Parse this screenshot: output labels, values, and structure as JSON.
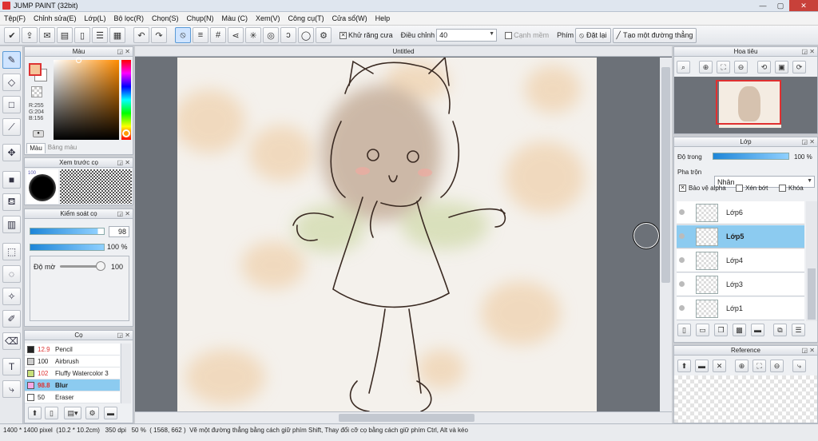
{
  "window": {
    "title": "JUMP PAINT (32bit)",
    "min": "—",
    "max": "▢",
    "close": "✕"
  },
  "menu": [
    "Tệp(F)",
    "Chỉnh sửa(E)",
    "Lớp(L)",
    "Bộ lọc(R)",
    "Chọn(S)",
    "Chụp(N)",
    "Màu (C)",
    "Xem(V)",
    "Công cụ(T)",
    "Cửa sổ(W)",
    "Help"
  ],
  "toolbar": {
    "antialias_label": "Khử răng cưa",
    "adjust_label": "Điều chỉnh",
    "adjust_value": "40",
    "edge_label": "Cạnh mềm",
    "key_label": "Phím",
    "reset_label": "Đặt lại",
    "line_label": "Tạo một đường thẳng"
  },
  "color_panel": {
    "title": "Màu",
    "r": "R:255",
    "g": "G:204",
    "b": "B:156",
    "tab_color": "Màu",
    "tab_palette": "Bảng màu",
    "fg": "#f4c59a",
    "bg": "#ffffff"
  },
  "brush_preview": {
    "title": "Xem trước cọ",
    "size": "100"
  },
  "brush_control": {
    "title": "Kiểm soát cọ",
    "size_value": "98",
    "size_fill": 0.92,
    "opacity_value": "100 %",
    "opacity_fill": 1.0,
    "density_label": "Độ mờ",
    "density_value": "100"
  },
  "brushes": {
    "title": "Cọ",
    "items": [
      {
        "size": "12.9",
        "name": "Pencil",
        "color": "#222222",
        "size_color": "#d33"
      },
      {
        "size": "100",
        "name": "Airbrush",
        "color": "#cccccc",
        "size_color": "#222"
      },
      {
        "size": "102",
        "name": "Fluffy Watercolor 3",
        "color": "#c8e07a",
        "size_color": "#d33"
      },
      {
        "size": "98.8",
        "name": "Blur",
        "color": "#f7a8e4",
        "size_color": "#d33"
      },
      {
        "size": "50",
        "name": "Eraser",
        "color": "#ffffff",
        "size_color": "#222"
      }
    ]
  },
  "canvas": {
    "tab": "Untitled"
  },
  "navigator": {
    "title": "Hoa tiêu"
  },
  "layers_panel": {
    "title": "Lớp",
    "opacity_label": "Độ trong",
    "opacity_value": "100 %",
    "opacity_fill": 1.0,
    "blend_label": "Pha trộn",
    "blend_value": "Nhân",
    "protect_alpha": "Bảo vệ alpha",
    "clip": "Xén bớt",
    "lock": "Khóa",
    "layers": [
      {
        "name": "Lớp6",
        "selected": false
      },
      {
        "name": "Lớp5",
        "selected": true
      },
      {
        "name": "Lớp4",
        "selected": false
      },
      {
        "name": "Lớp3",
        "selected": false
      },
      {
        "name": "Lớp1",
        "selected": false
      }
    ]
  },
  "reference": {
    "title": "Reference"
  },
  "status": {
    "size": "1400 * 1400 pixel",
    "cm": "(10.2 * 10.2cm)",
    "dpi": "350 dpi",
    "zoom": "50 %",
    "coords": "( 1568, 662 )",
    "hint": "Vẽ một đường thẳng bằng cách giữ phím Shift, Thay đổi cỡ cọ bằng cách giữ phím Ctrl, Alt và kéo"
  }
}
